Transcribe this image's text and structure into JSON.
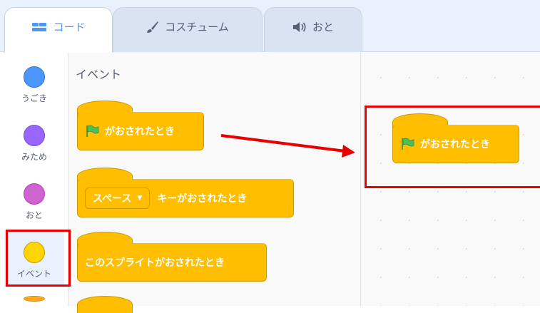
{
  "tabs": [
    {
      "label": "コード",
      "icon": "code-icon",
      "active": true
    },
    {
      "label": "コスチューム",
      "icon": "brush-icon",
      "active": false
    },
    {
      "label": "おと",
      "icon": "speaker-icon",
      "active": false
    }
  ],
  "categories": [
    {
      "label": "うごき",
      "color": "#4c97ff",
      "border": "#3373cc",
      "selected": false
    },
    {
      "label": "みため",
      "color": "#9966ff",
      "border": "#774dcb",
      "selected": false
    },
    {
      "label": "おと",
      "color": "#cf63cf",
      "border": "#bd42bd",
      "selected": false
    },
    {
      "label": "イベント",
      "color": "#ffd500",
      "border": "#cc9900",
      "selected": true
    },
    {
      "label": "",
      "color": "#ffab19",
      "border": "#cf8b17",
      "selected": false
    }
  ],
  "palette": {
    "title": "イベント",
    "blocks": {
      "flag_clicked": "がおされたとき",
      "key_pressed_dropdown": "スペース",
      "key_pressed_suffix": "キーがおされたとき",
      "sprite_clicked": "このスプライトがおされたとき"
    }
  },
  "workspace": {
    "block_label": "がおされたとき"
  },
  "colors": {
    "event_block": "#ffbf00",
    "event_block_border": "#cc9900",
    "annotation_red": "#e60000",
    "flag_green": "#4cbf56"
  }
}
